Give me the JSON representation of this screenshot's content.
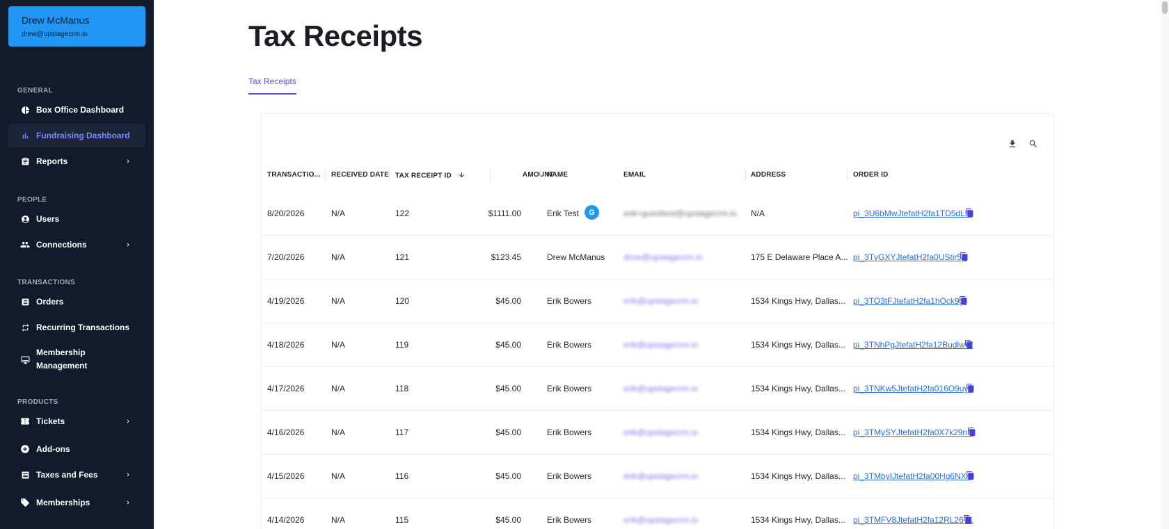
{
  "user": {
    "name": "Drew McManus",
    "email": "drew@upstagecrm.io"
  },
  "sidebar": {
    "sections": [
      {
        "label": "GENERAL"
      },
      {
        "label": "PEOPLE"
      },
      {
        "label": "TRANSACTIONS"
      },
      {
        "label": "PRODUCTS"
      }
    ],
    "items": [
      {
        "label": "Box Office Dashboard"
      },
      {
        "label": "Fundraising Dashboard"
      },
      {
        "label": "Reports"
      },
      {
        "label": "Users"
      },
      {
        "label": "Connections"
      },
      {
        "label": "Orders"
      },
      {
        "label": "Recurring Transactions"
      },
      {
        "label": "Membership Management"
      },
      {
        "label": "Tickets"
      },
      {
        "label": "Add-ons"
      },
      {
        "label": "Taxes and Fees"
      },
      {
        "label": "Memberships"
      }
    ]
  },
  "page": {
    "title": "Tax Receipts",
    "tab": "Tax Receipts"
  },
  "table": {
    "headers": {
      "transaction": "TRANSACTIO...",
      "received": "RECEIVED DATE",
      "receipt_id": "TAX RECEIPT ID",
      "amount": "AMOUNT",
      "name": "NAME",
      "email": "EMAIL",
      "address": "ADDRESS",
      "order": "ORDER ID"
    },
    "rows": [
      {
        "date": "8/20/2026",
        "received": "N/A",
        "id": "122",
        "amount": "$1111.00",
        "name": "Erik Test",
        "badge": "G",
        "email": "erik+guesttest@upstagecrm.io",
        "address": "N/A",
        "order": "pi_3U6bMwJtefatH2fa1TD5dLfb"
      },
      {
        "date": "7/20/2026",
        "received": "N/A",
        "id": "121",
        "amount": "$123.45",
        "name": "Drew McManus",
        "email": "drew@upstagecrm.io",
        "address": "175 E Delaware Place A...",
        "order": "pi_3TvGXYJtefatH2fa0UStir5p"
      },
      {
        "date": "4/19/2026",
        "received": "N/A",
        "id": "120",
        "amount": "$45.00",
        "name": "Erik Bowers",
        "email": "erik@upstagecrm.io",
        "address": "1534 Kings Hwy, Dallas...",
        "order": "pi_3TO3tFJtefatH2fa1hOck9gt"
      },
      {
        "date": "4/18/2026",
        "received": "N/A",
        "id": "119",
        "amount": "$45.00",
        "name": "Erik Bowers",
        "email": "erik@upstagecrm.io",
        "address": "1534 Kings Hwy, Dallas...",
        "order": "pi_3TNhPgJtefatH2fa12BudlwW"
      },
      {
        "date": "4/17/2026",
        "received": "N/A",
        "id": "118",
        "amount": "$45.00",
        "name": "Erik Bowers",
        "email": "erik@upstagecrm.io",
        "address": "1534 Kings Hwy, Dallas...",
        "order": "pi_3TNKw5JtefatH2fa016O9uy0"
      },
      {
        "date": "4/16/2026",
        "received": "N/A",
        "id": "117",
        "amount": "$45.00",
        "name": "Erik Bowers",
        "email": "erik@upstagecrm.io",
        "address": "1534 Kings Hwy, Dallas...",
        "order": "pi_3TMySYJtefatH2fa0X7k29nN"
      },
      {
        "date": "4/15/2026",
        "received": "N/A",
        "id": "116",
        "amount": "$45.00",
        "name": "Erik Bowers",
        "email": "erik@upstagecrm.io",
        "address": "1534 Kings Hwy, Dallas...",
        "order": "pi_3TMbyIJtefatH2fa00Hg6NXs"
      },
      {
        "date": "4/14/2026",
        "received": "N/A",
        "id": "115",
        "amount": "$45.00",
        "name": "Erik Bowers",
        "email": "erik@upstagecrm.io",
        "address": "1534 Kings Hwy, Dallas...",
        "order": "pi_3TMFV8JtefatH2fa12RL26T1"
      }
    ]
  },
  "colors": {
    "sidebar_bg": "#121a2c",
    "accent": "#2196f3",
    "active_nav": "#7b86ff",
    "link": "#2a6fd6",
    "tab_accent": "#5b4bdb"
  }
}
